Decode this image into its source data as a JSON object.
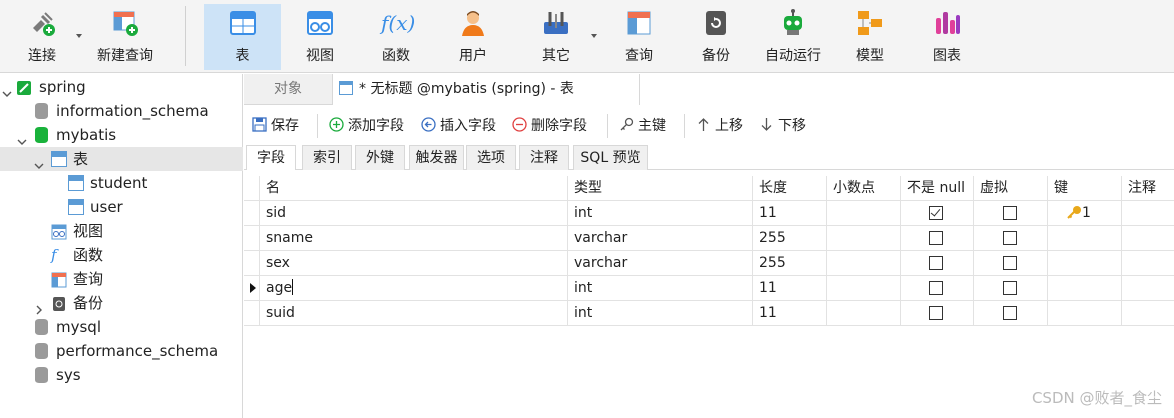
{
  "toolbar": {
    "buttons": [
      {
        "label": "连接",
        "icon": "plug-icon"
      },
      {
        "label": "新建查询",
        "icon": "new-query-icon"
      },
      {
        "label": "表",
        "icon": "table-icon"
      },
      {
        "label": "视图",
        "icon": "view-icon"
      },
      {
        "label": "函数",
        "icon": "function-icon"
      },
      {
        "label": "用户",
        "icon": "user-icon"
      },
      {
        "label": "其它",
        "icon": "tools-icon"
      },
      {
        "label": "查询",
        "icon": "query-icon"
      },
      {
        "label": "备份",
        "icon": "backup-icon"
      },
      {
        "label": "自动运行",
        "icon": "robot-icon"
      },
      {
        "label": "模型",
        "icon": "model-icon"
      },
      {
        "label": "图表",
        "icon": "chart-icon"
      }
    ],
    "function_glyph": "f(x)"
  },
  "sidebar": {
    "connection": "spring",
    "items": [
      {
        "label": "information_schema"
      },
      {
        "label": "mybatis"
      },
      {
        "label": "表"
      },
      {
        "label": "student"
      },
      {
        "label": "user"
      },
      {
        "label": "视图"
      },
      {
        "label": "函数"
      },
      {
        "label": "查询"
      },
      {
        "label": "备份"
      },
      {
        "label": "mysql"
      },
      {
        "label": "performance_schema"
      },
      {
        "label": "sys"
      }
    ]
  },
  "tabs": {
    "objects": "对象",
    "current": "* 无标题 @mybatis (spring) - 表"
  },
  "actions": {
    "save": "保存",
    "add_field": "添加字段",
    "insert_field": "插入字段",
    "delete_field": "删除字段",
    "primary_key": "主键",
    "move_up": "上移",
    "move_down": "下移"
  },
  "subtabs": [
    "字段",
    "索引",
    "外键",
    "触发器",
    "选项",
    "注释",
    "SQL 预览"
  ],
  "grid": {
    "headers": [
      "名",
      "类型",
      "长度",
      "小数点",
      "不是 null",
      "虚拟",
      "键",
      "注释"
    ],
    "rows": [
      {
        "name": "sid",
        "type": "int",
        "length": "11",
        "not_null": true,
        "virtual": false,
        "key": "1"
      },
      {
        "name": "sname",
        "type": "varchar",
        "length": "255",
        "not_null": false,
        "virtual": false,
        "key": ""
      },
      {
        "name": "sex",
        "type": "varchar",
        "length": "255",
        "not_null": false,
        "virtual": false,
        "key": ""
      },
      {
        "name": "age",
        "type": "int",
        "length": "11",
        "not_null": false,
        "virtual": false,
        "key": ""
      },
      {
        "name": "suid",
        "type": "int",
        "length": "11",
        "not_null": false,
        "virtual": false,
        "key": ""
      }
    ]
  },
  "watermark": "CSDN @败者_食尘"
}
